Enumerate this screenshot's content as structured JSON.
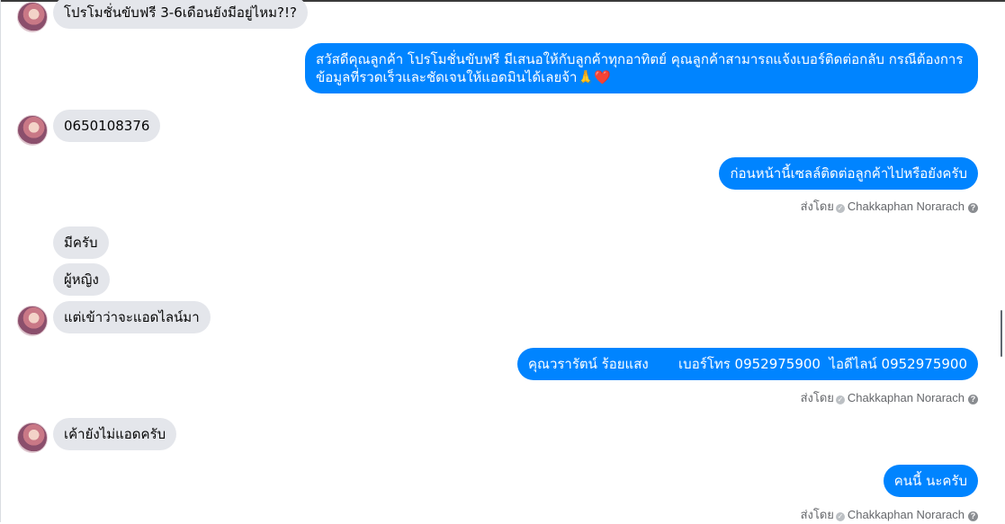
{
  "messages": {
    "m1": "โปรโมชั่นขับฟรี 3-6เดือนยังมีอยู่ไหม?!?",
    "m2": "สวัสดีคุณลูกค้า โปรโมชั่นขับฟรี มีเสนอให้กับลูกค้าทุกอาทิตย์ คุณลูกค้าสามารถแจ้งเบอร์ติดต่อกลับ กรณีต้องการข้อมูลที่รวดเร็วและชัดเจนให้แอดมินได้เลยจ้า🙏❤️",
    "m3": "0650108376",
    "m4": "ก่อนหน้านี้เซลล์ติดต่อลูกค้าไปหรือยังครับ",
    "m5": "มีครับ",
    "m6": "ผู้หญิง",
    "m7": "แต่เข้าว่าจะแอดไลน์มา",
    "m8": "คุณวรารัตน์ ร้อยแสง       เบอร์โทร 0952975900  ไอดีไลน์ 0952975900",
    "m9": "เค้ายังไม่แอดครับ",
    "m10": "คนนี้ นะครับ"
  },
  "sent_by": {
    "label": "ส่งโดย",
    "name": "Chakkaphan Norarach",
    "check_icon": "✓",
    "help_icon": "?"
  },
  "colors": {
    "incoming": "#e4e6eb",
    "outgoing": "#0084ff"
  }
}
